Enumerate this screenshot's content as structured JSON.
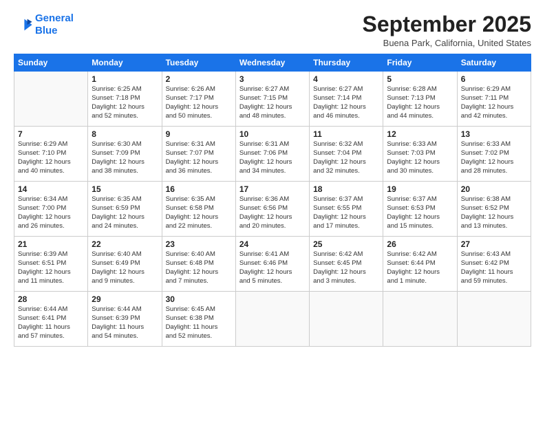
{
  "logo": {
    "line1": "General",
    "line2": "Blue"
  },
  "header": {
    "month": "September 2025",
    "location": "Buena Park, California, United States"
  },
  "weekdays": [
    "Sunday",
    "Monday",
    "Tuesday",
    "Wednesday",
    "Thursday",
    "Friday",
    "Saturday"
  ],
  "weeks": [
    [
      {
        "day": "",
        "content": ""
      },
      {
        "day": "1",
        "content": "Sunrise: 6:25 AM\nSunset: 7:18 PM\nDaylight: 12 hours\nand 52 minutes."
      },
      {
        "day": "2",
        "content": "Sunrise: 6:26 AM\nSunset: 7:17 PM\nDaylight: 12 hours\nand 50 minutes."
      },
      {
        "day": "3",
        "content": "Sunrise: 6:27 AM\nSunset: 7:15 PM\nDaylight: 12 hours\nand 48 minutes."
      },
      {
        "day": "4",
        "content": "Sunrise: 6:27 AM\nSunset: 7:14 PM\nDaylight: 12 hours\nand 46 minutes."
      },
      {
        "day": "5",
        "content": "Sunrise: 6:28 AM\nSunset: 7:13 PM\nDaylight: 12 hours\nand 44 minutes."
      },
      {
        "day": "6",
        "content": "Sunrise: 6:29 AM\nSunset: 7:11 PM\nDaylight: 12 hours\nand 42 minutes."
      }
    ],
    [
      {
        "day": "7",
        "content": "Sunrise: 6:29 AM\nSunset: 7:10 PM\nDaylight: 12 hours\nand 40 minutes."
      },
      {
        "day": "8",
        "content": "Sunrise: 6:30 AM\nSunset: 7:09 PM\nDaylight: 12 hours\nand 38 minutes."
      },
      {
        "day": "9",
        "content": "Sunrise: 6:31 AM\nSunset: 7:07 PM\nDaylight: 12 hours\nand 36 minutes."
      },
      {
        "day": "10",
        "content": "Sunrise: 6:31 AM\nSunset: 7:06 PM\nDaylight: 12 hours\nand 34 minutes."
      },
      {
        "day": "11",
        "content": "Sunrise: 6:32 AM\nSunset: 7:04 PM\nDaylight: 12 hours\nand 32 minutes."
      },
      {
        "day": "12",
        "content": "Sunrise: 6:33 AM\nSunset: 7:03 PM\nDaylight: 12 hours\nand 30 minutes."
      },
      {
        "day": "13",
        "content": "Sunrise: 6:33 AM\nSunset: 7:02 PM\nDaylight: 12 hours\nand 28 minutes."
      }
    ],
    [
      {
        "day": "14",
        "content": "Sunrise: 6:34 AM\nSunset: 7:00 PM\nDaylight: 12 hours\nand 26 minutes."
      },
      {
        "day": "15",
        "content": "Sunrise: 6:35 AM\nSunset: 6:59 PM\nDaylight: 12 hours\nand 24 minutes."
      },
      {
        "day": "16",
        "content": "Sunrise: 6:35 AM\nSunset: 6:58 PM\nDaylight: 12 hours\nand 22 minutes."
      },
      {
        "day": "17",
        "content": "Sunrise: 6:36 AM\nSunset: 6:56 PM\nDaylight: 12 hours\nand 20 minutes."
      },
      {
        "day": "18",
        "content": "Sunrise: 6:37 AM\nSunset: 6:55 PM\nDaylight: 12 hours\nand 17 minutes."
      },
      {
        "day": "19",
        "content": "Sunrise: 6:37 AM\nSunset: 6:53 PM\nDaylight: 12 hours\nand 15 minutes."
      },
      {
        "day": "20",
        "content": "Sunrise: 6:38 AM\nSunset: 6:52 PM\nDaylight: 12 hours\nand 13 minutes."
      }
    ],
    [
      {
        "day": "21",
        "content": "Sunrise: 6:39 AM\nSunset: 6:51 PM\nDaylight: 12 hours\nand 11 minutes."
      },
      {
        "day": "22",
        "content": "Sunrise: 6:40 AM\nSunset: 6:49 PM\nDaylight: 12 hours\nand 9 minutes."
      },
      {
        "day": "23",
        "content": "Sunrise: 6:40 AM\nSunset: 6:48 PM\nDaylight: 12 hours\nand 7 minutes."
      },
      {
        "day": "24",
        "content": "Sunrise: 6:41 AM\nSunset: 6:46 PM\nDaylight: 12 hours\nand 5 minutes."
      },
      {
        "day": "25",
        "content": "Sunrise: 6:42 AM\nSunset: 6:45 PM\nDaylight: 12 hours\nand 3 minutes."
      },
      {
        "day": "26",
        "content": "Sunrise: 6:42 AM\nSunset: 6:44 PM\nDaylight: 12 hours\nand 1 minute."
      },
      {
        "day": "27",
        "content": "Sunrise: 6:43 AM\nSunset: 6:42 PM\nDaylight: 11 hours\nand 59 minutes."
      }
    ],
    [
      {
        "day": "28",
        "content": "Sunrise: 6:44 AM\nSunset: 6:41 PM\nDaylight: 11 hours\nand 57 minutes."
      },
      {
        "day": "29",
        "content": "Sunrise: 6:44 AM\nSunset: 6:39 PM\nDaylight: 11 hours\nand 54 minutes."
      },
      {
        "day": "30",
        "content": "Sunrise: 6:45 AM\nSunset: 6:38 PM\nDaylight: 11 hours\nand 52 minutes."
      },
      {
        "day": "",
        "content": ""
      },
      {
        "day": "",
        "content": ""
      },
      {
        "day": "",
        "content": ""
      },
      {
        "day": "",
        "content": ""
      }
    ]
  ]
}
